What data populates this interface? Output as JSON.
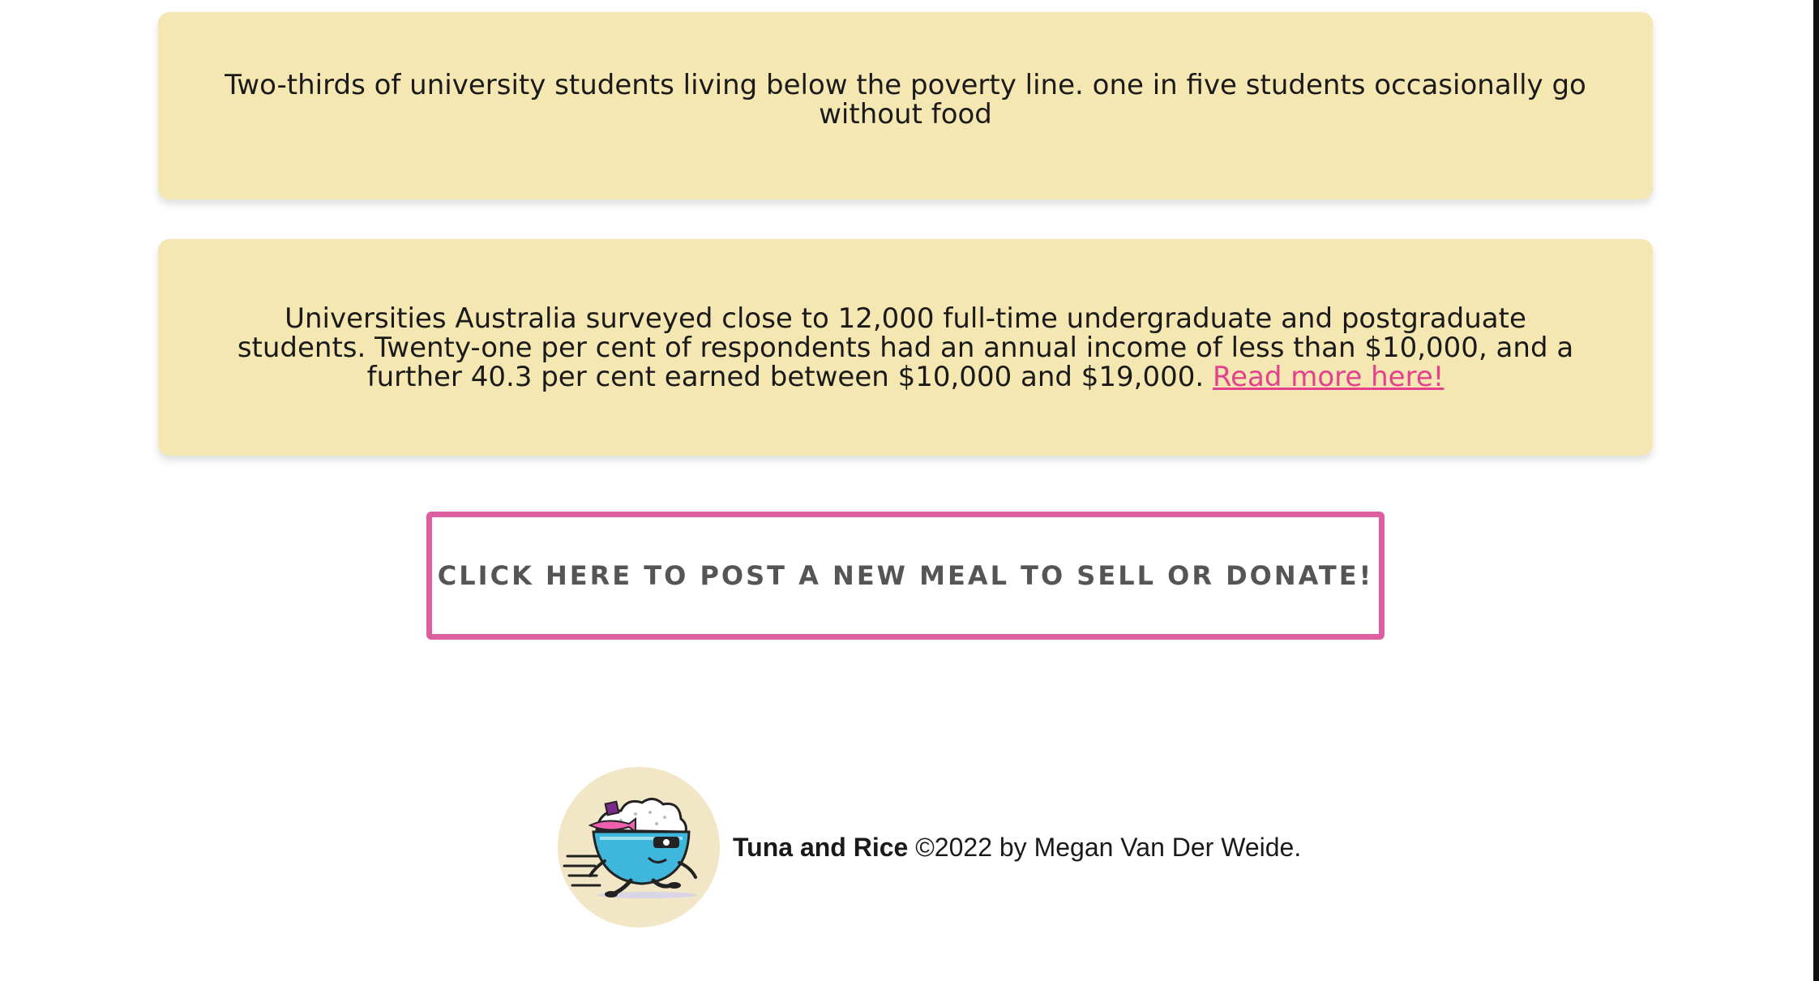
{
  "cards": [
    {
      "text": "Two-thirds of university students living below the poverty line. one in five students occasionally go without food"
    },
    {
      "text": "Universities Australia surveyed close to 12,000 full-time undergraduate and postgraduate students. Twenty-one per cent of respondents had an annual income of less than $10,000, and a further 40.3 per cent earned between $10,000 and $19,000. ",
      "link_label": "Read more here!"
    }
  ],
  "cta": {
    "label": "CLICK HERE TO POST A NEW MEAL TO SELL OR DONATE!"
  },
  "footer": {
    "brand": "Tuna and Rice",
    "copyright": " ©2022 by Megan Van Der Weide.",
    "logo_icon": "tuna-rice-bowl-logo"
  },
  "colors": {
    "card_bg": "#f5e7b1",
    "accent": "#dd5fa0",
    "link": "#e3408f",
    "cta_text": "#555555"
  }
}
